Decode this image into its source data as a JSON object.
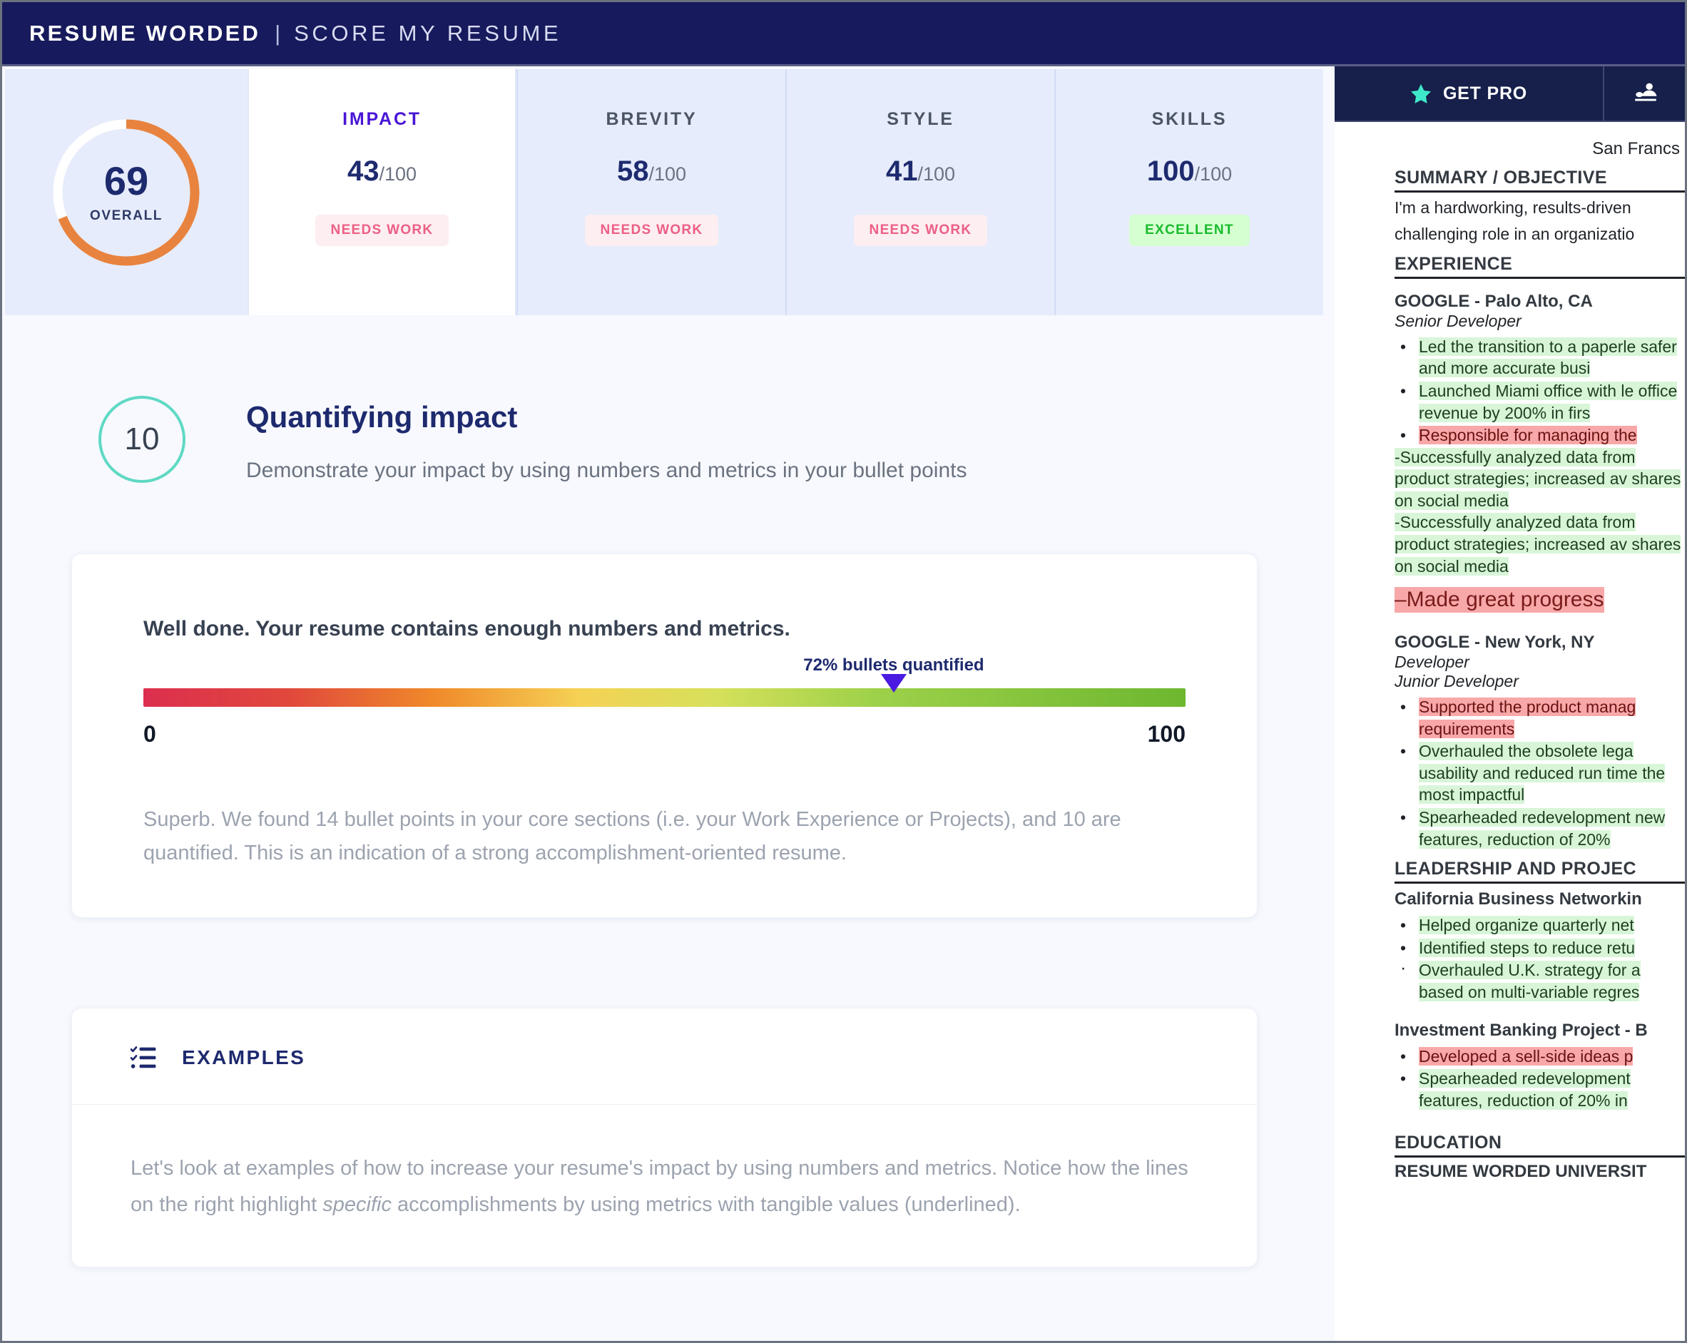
{
  "header": {
    "brand_strong": "RESUME WORDED",
    "separator": "|",
    "brand_light": "SCORE MY RESUME"
  },
  "scores": {
    "overall": {
      "value": "69",
      "label": "OVERALL",
      "percent": 69,
      "arc_color": "#e8833f",
      "track_color": "#ffffff"
    },
    "cards": [
      {
        "title": "IMPACT",
        "value": "43",
        "max": "/100",
        "badge": "NEEDS WORK",
        "badge_type": "needswork",
        "active": true
      },
      {
        "title": "BREVITY",
        "value": "58",
        "max": "/100",
        "badge": "NEEDS WORK",
        "badge_type": "needswork",
        "active": false
      },
      {
        "title": "STYLE",
        "value": "41",
        "max": "/100",
        "badge": "NEEDS WORK",
        "badge_type": "needswork",
        "active": false
      },
      {
        "title": "SKILLS",
        "value": "100",
        "max": "/100",
        "badge": "EXCELLENT",
        "badge_type": "excellent",
        "active": false
      }
    ]
  },
  "section": {
    "number": "10",
    "title": "Quantifying impact",
    "subtitle": "Demonstrate your impact by using numbers and metrics in your bullet points"
  },
  "metrics_card": {
    "title": "Well done. Your resume contains enough numbers and metrics.",
    "bar_caption": "72% bullets quantified",
    "bar_percent": 72,
    "scale_min": "0",
    "scale_max": "100",
    "description": "Superb. We found 14 bullet points in your core sections (i.e. your Work Experience or Projects), and 10 are quantified. This is an indication of a strong accomplishment-oriented resume."
  },
  "examples_card": {
    "icon": "checklist-icon",
    "title": "EXAMPLES",
    "body_part1": "Let's look at examples of how to increase your resume's impact by using numbers and metrics. Notice how the lines on the right highlight ",
    "body_italic": "specific",
    "body_part2": " accomplishments by using metrics with tangible values (underlined)."
  },
  "resume_panel": {
    "toolbar": {
      "pro_label": "GET PRO",
      "star_icon": "star-icon",
      "upload_icon": "upload-person-icon",
      "star_color": "#3ee8c8",
      "bar_color": "#16204a"
    },
    "location": "San Francs",
    "sections": [
      {
        "heading": "SUMMARY / OBJECTIVE",
        "paragraphs": [
          "I'm a hardworking, results-driven",
          "challenging role in an organizatio"
        ]
      },
      {
        "heading": "EXPERIENCE",
        "jobs": [
          {
            "company": "GOOGLE - Palo Alto, CA",
            "roles": [
              "Senior Developer"
            ],
            "bullets": [
              {
                "text": "Led the transition to a paperle safer and more accurate busi",
                "highlight": "green",
                "marker": "bullet"
              },
              {
                "text": "Launched Miami office with le office revenue by 200% in firs",
                "highlight": "green",
                "marker": "bullet"
              },
              {
                "text": "Responsible for managing the",
                "highlight": "red",
                "marker": "bullet"
              }
            ],
            "extra_lines": [
              {
                "text": "-Successfully analyzed data from product strategies; increased av shares on social media",
                "highlight": "green"
              },
              {
                "text": "-Successfully analyzed data from product strategies; increased av shares on social media",
                "highlight": "green"
              }
            ],
            "big_red": "–Made great progress"
          },
          {
            "company": "GOOGLE - New York, NY",
            "roles": [
              "Developer",
              "Junior Developer"
            ],
            "bullets": [
              {
                "text": "Supported the product manag requirements",
                "highlight": "red",
                "marker": "bullet"
              },
              {
                "text": "Overhauled the obsolete lega usability and reduced run time the most impactful",
                "highlight": "green",
                "marker": "bullet"
              },
              {
                "text": "Spearheaded redevelopment new features, reduction of 20%",
                "highlight": "green",
                "marker": "bullet"
              }
            ],
            "extra_lines": [],
            "big_red": ""
          }
        ]
      },
      {
        "heading": "LEADERSHIP AND PROJEC",
        "jobs": [
          {
            "company": "California Business Networkin",
            "roles": [],
            "bullets": [
              {
                "text": "Helped organize quarterly net",
                "highlight": "green",
                "marker": "bullet"
              },
              {
                "text": "Identified steps to reduce retu",
                "highlight": "green",
                "marker": "bullet"
              },
              {
                "text": "Overhauled U.K. strategy for a based on multi-variable regres",
                "highlight": "green",
                "marker": "dot-small"
              }
            ],
            "extra_lines": [],
            "big_red": ""
          },
          {
            "company": "Investment Banking Project - B",
            "roles": [],
            "bullets": [
              {
                "text": "Developed a sell-side ideas p",
                "highlight": "red",
                "marker": "bullet"
              },
              {
                "text": "Spearheaded redevelopment features, reduction of 20% in",
                "highlight": "green",
                "marker": "bullet"
              }
            ],
            "extra_lines": [],
            "big_red": ""
          }
        ]
      },
      {
        "heading": "EDUCATION",
        "footer": "RESUME WORDED UNIVERSIT"
      }
    ]
  }
}
